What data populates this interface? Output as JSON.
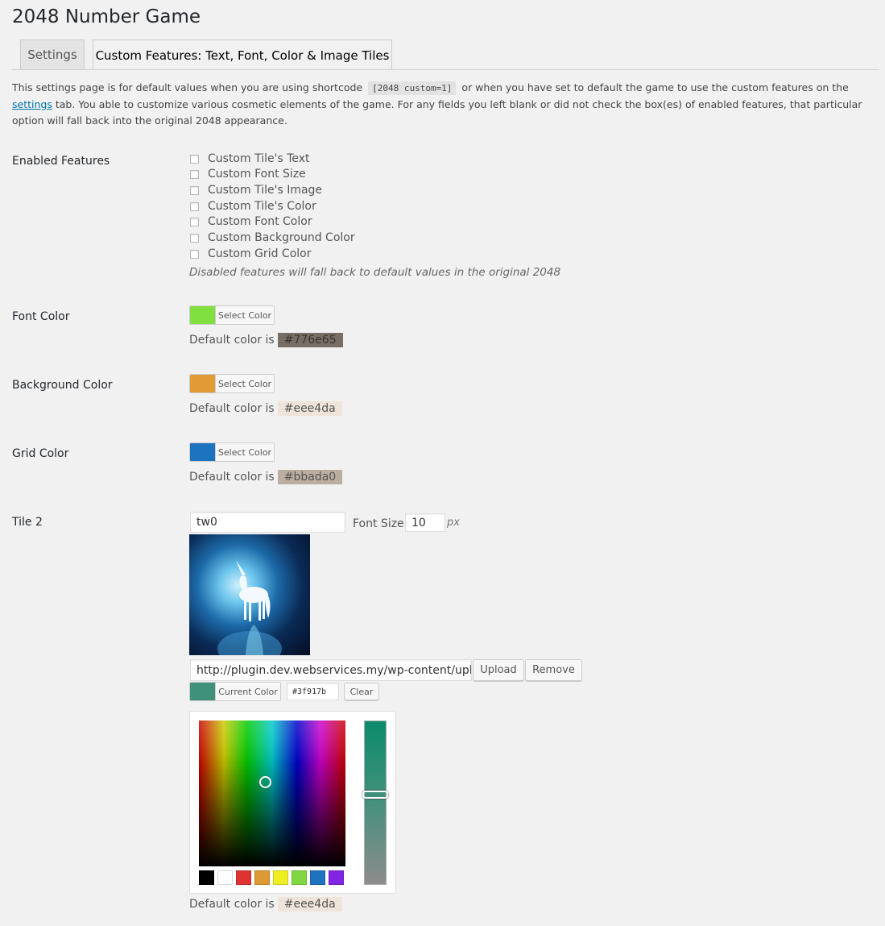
{
  "page": {
    "title": "2048 Number Game"
  },
  "tabs": [
    {
      "label": "Settings",
      "active": false
    },
    {
      "label": "Custom Features: Text, Font, Color & Image Tiles",
      "active": true
    }
  ],
  "description": {
    "part1": "This settings page is for default values when you are using shortcode",
    "code": "[2048 custom=1]",
    "part2": "or when you have set to default the game to use the custom features on the",
    "link": "settings",
    "part3": "tab. You able to customize various cosmetic elements of the game. For any fields you left blank or did not check the box(es) of enabled features, that particular option will fall back into the original 2048 appearance."
  },
  "enabled_features": {
    "label": "Enabled Features",
    "options": [
      {
        "label": "Custom Tile's Text",
        "checked": false
      },
      {
        "label": "Custom Font Size",
        "checked": false
      },
      {
        "label": "Custom Tile's Image",
        "checked": false
      },
      {
        "label": "Custom Tile's Color",
        "checked": false
      },
      {
        "label": "Custom Font Color",
        "checked": false
      },
      {
        "label": "Custom Background Color",
        "checked": false
      },
      {
        "label": "Custom Grid Color",
        "checked": false
      }
    ],
    "note": "Disabled features will fall back to default values in the original 2048"
  },
  "font_color": {
    "label": "Font Color",
    "button_label": "Select Color",
    "swatch": "#80e040",
    "default_prefix": "Default color is",
    "default_value": "#776e65"
  },
  "background_color": {
    "label": "Background Color",
    "button_label": "Select Color",
    "swatch": "#e09b36",
    "default_prefix": "Default color is",
    "default_value": "#eee4da"
  },
  "grid_color": {
    "label": "Grid Color",
    "button_label": "Select Color",
    "swatch": "#1e73be",
    "default_prefix": "Default color is",
    "default_value": "#bbada0"
  },
  "tile2": {
    "label": "Tile 2",
    "text_value": "tw0",
    "font_size_label": "Font Size",
    "font_size_value": "10",
    "font_size_unit": "px",
    "image_url": "http://plugin.dev.webservices.my/wp-content/uplo",
    "upload_label": "Upload",
    "remove_label": "Remove",
    "current_color_label": "Current Color",
    "current_color_value": "#3f917b",
    "clear_label": "Clear",
    "palette": [
      "#000000",
      "#ffffff",
      "#dd3333",
      "#dd9933",
      "#eeee22",
      "#81d742",
      "#1e73be",
      "#8224e3"
    ],
    "default_prefix": "Default color is",
    "default_value": "#eee4da"
  }
}
